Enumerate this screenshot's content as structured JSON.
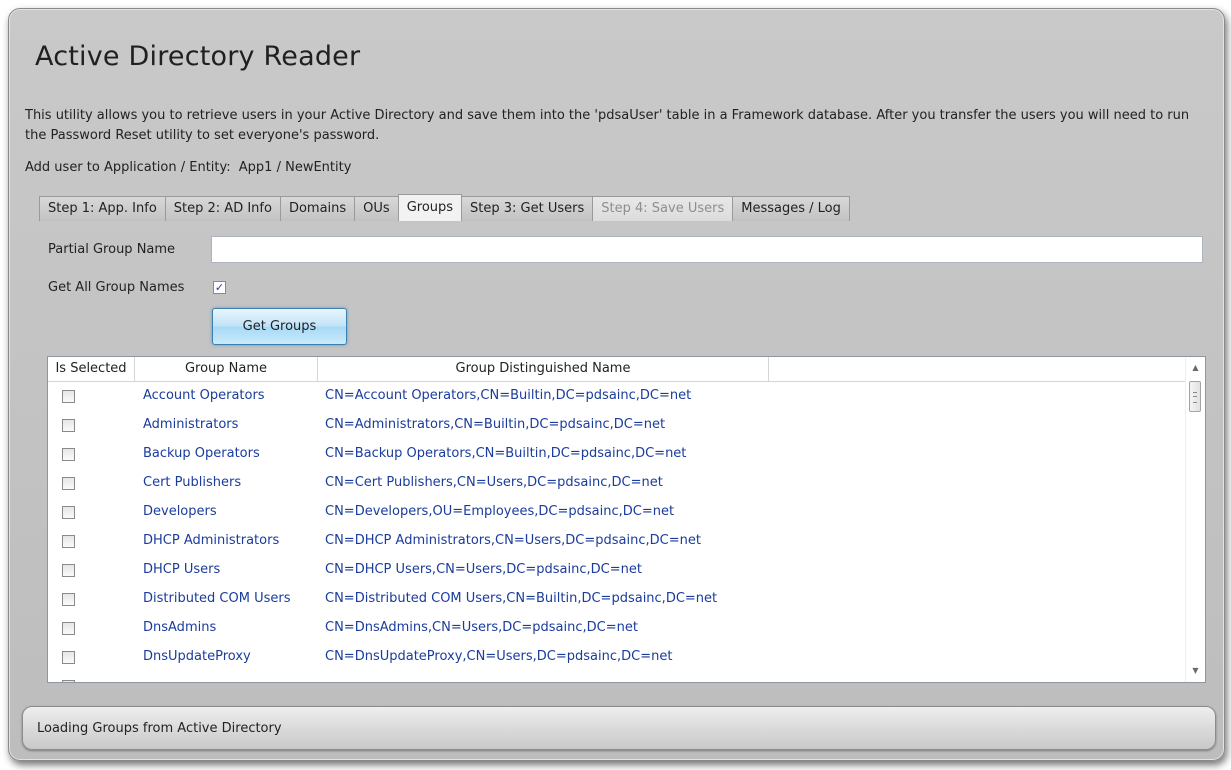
{
  "app": {
    "title": "Active Directory Reader",
    "description": "This utility allows you to retrieve users in your Active Directory and save them into the 'pdsaUser' table in a Framework database. After you transfer the users you will need to run the Password Reset utility to set everyone's password.",
    "entity_label": "Add user to Application / Entity:",
    "entity_value": "App1 / NewEntity"
  },
  "tabs": [
    {
      "label": "Step 1: App. Info",
      "state": "normal"
    },
    {
      "label": "Step 2: AD Info",
      "state": "normal"
    },
    {
      "label": "Domains",
      "state": "normal"
    },
    {
      "label": "OUs",
      "state": "normal"
    },
    {
      "label": "Groups",
      "state": "active"
    },
    {
      "label": "Step 3: Get Users",
      "state": "normal"
    },
    {
      "label": "Step 4: Save Users",
      "state": "disabled"
    },
    {
      "label": "Messages / Log",
      "state": "normal"
    }
  ],
  "groups_tab": {
    "partial_label": "Partial Group Name",
    "partial_value": "",
    "get_all_label": "Get All Group Names",
    "get_all_checked": true,
    "get_groups_button": "Get Groups"
  },
  "grid": {
    "headers": [
      "Is Selected",
      "Group Name",
      "Group Distinguished Name"
    ],
    "rows": [
      {
        "selected": false,
        "name": "Account Operators",
        "dn": "CN=Account Operators,CN=Builtin,DC=pdsainc,DC=net"
      },
      {
        "selected": false,
        "name": "Administrators",
        "dn": "CN=Administrators,CN=Builtin,DC=pdsainc,DC=net"
      },
      {
        "selected": false,
        "name": "Backup Operators",
        "dn": "CN=Backup Operators,CN=Builtin,DC=pdsainc,DC=net"
      },
      {
        "selected": false,
        "name": "Cert Publishers",
        "dn": "CN=Cert Publishers,CN=Users,DC=pdsainc,DC=net"
      },
      {
        "selected": false,
        "name": "Developers",
        "dn": "CN=Developers,OU=Employees,DC=pdsainc,DC=net"
      },
      {
        "selected": false,
        "name": "DHCP Administrators",
        "dn": "CN=DHCP Administrators,CN=Users,DC=pdsainc,DC=net"
      },
      {
        "selected": false,
        "name": "DHCP Users",
        "dn": "CN=DHCP Users,CN=Users,DC=pdsainc,DC=net"
      },
      {
        "selected": false,
        "name": "Distributed COM Users",
        "dn": "CN=Distributed COM Users,CN=Builtin,DC=pdsainc,DC=net"
      },
      {
        "selected": false,
        "name": "DnsAdmins",
        "dn": "CN=DnsAdmins,CN=Users,DC=pdsainc,DC=net"
      },
      {
        "selected": false,
        "name": "DnsUpdateProxy",
        "dn": "CN=DnsUpdateProxy,CN=Users,DC=pdsainc,DC=net"
      }
    ]
  },
  "status": {
    "text": "Loading Groups from Active Directory"
  },
  "icons": {
    "scroll_up": "chevron-up-icon",
    "scroll_down": "chevron-down-icon",
    "checkmark": "checkmark-icon"
  },
  "colors": {
    "link_text": "#1a3c9c",
    "window_bg": "#c4c4c4",
    "button_accent": "#3c7fb1"
  }
}
